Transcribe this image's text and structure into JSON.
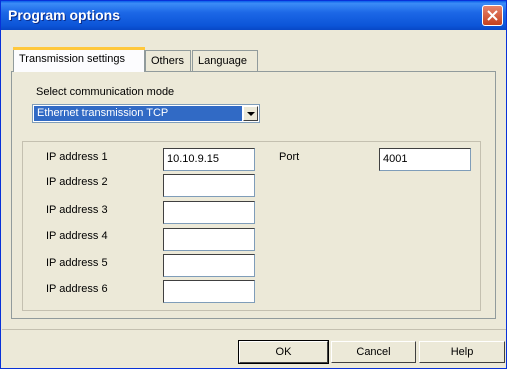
{
  "window": {
    "title": "Program options"
  },
  "tabs": [
    {
      "label": "Transmission settings",
      "active": true
    },
    {
      "label": "Others",
      "active": false
    },
    {
      "label": "Language",
      "active": false
    }
  ],
  "comm": {
    "label": "Select communication mode",
    "value": "Ethernet transmission TCP"
  },
  "ip_fields": [
    {
      "label": "IP address 1",
      "value": "10.10.9.15"
    },
    {
      "label": "IP address 2",
      "value": ""
    },
    {
      "label": "IP address 3",
      "value": ""
    },
    {
      "label": "IP address 4",
      "value": ""
    },
    {
      "label": "IP address 5",
      "value": ""
    },
    {
      "label": "IP address 6",
      "value": ""
    }
  ],
  "port": {
    "label": "Port",
    "value": "4001"
  },
  "buttons": {
    "ok": "OK",
    "cancel": "Cancel",
    "help": "Help"
  },
  "colors": {
    "titlebar": "#0c55d8",
    "selection": "#316ac5",
    "dialog_bg": "#ece9d8"
  }
}
